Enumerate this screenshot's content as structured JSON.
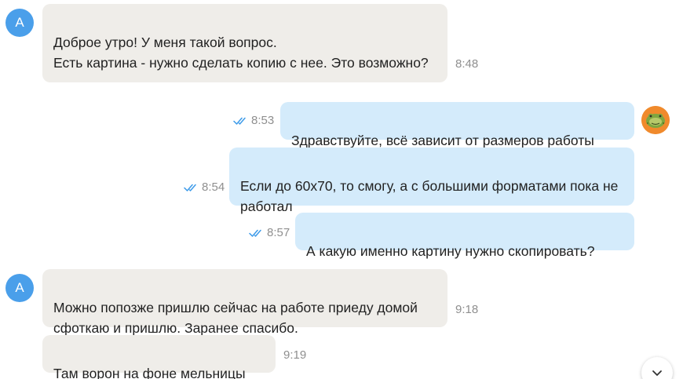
{
  "contact": {
    "avatar_letter": "A"
  },
  "messages": [
    {
      "direction": "in",
      "text": "Доброе утро! У меня такой вопрос.\nЕсть картина - нужно сделать копию с нее. Это возможно?",
      "time": "8:48"
    },
    {
      "direction": "out",
      "text": "Здравствуйте, всё зависит от размеров работы",
      "time": "8:53",
      "status": "read"
    },
    {
      "direction": "out",
      "text": "Если до 60х70, то смогу, а с большими форматами пока не работал",
      "time": "8:54",
      "status": "read"
    },
    {
      "direction": "out",
      "text": "А какую именно картину нужно скопировать?",
      "time": "8:57",
      "status": "read"
    },
    {
      "direction": "in",
      "text": "Можно попозже пришлю сейчас на работе приеду домой сфоткаю и пришлю. Заранее спасибо.",
      "time": "9:18"
    },
    {
      "direction": "in",
      "text": "Там ворон на фоне мельницы",
      "time": "9:19"
    }
  ],
  "colors": {
    "incoming_bubble": "#efede9",
    "outgoing_bubble": "#d4ebfb",
    "avatar_letter_bg": "#4a9fea",
    "read_ticks": "#3d9be9"
  },
  "icons": {
    "read_status": "double-check-icon",
    "scroll_down": "chevron-down-icon",
    "own_avatar": "frog-avatar"
  }
}
